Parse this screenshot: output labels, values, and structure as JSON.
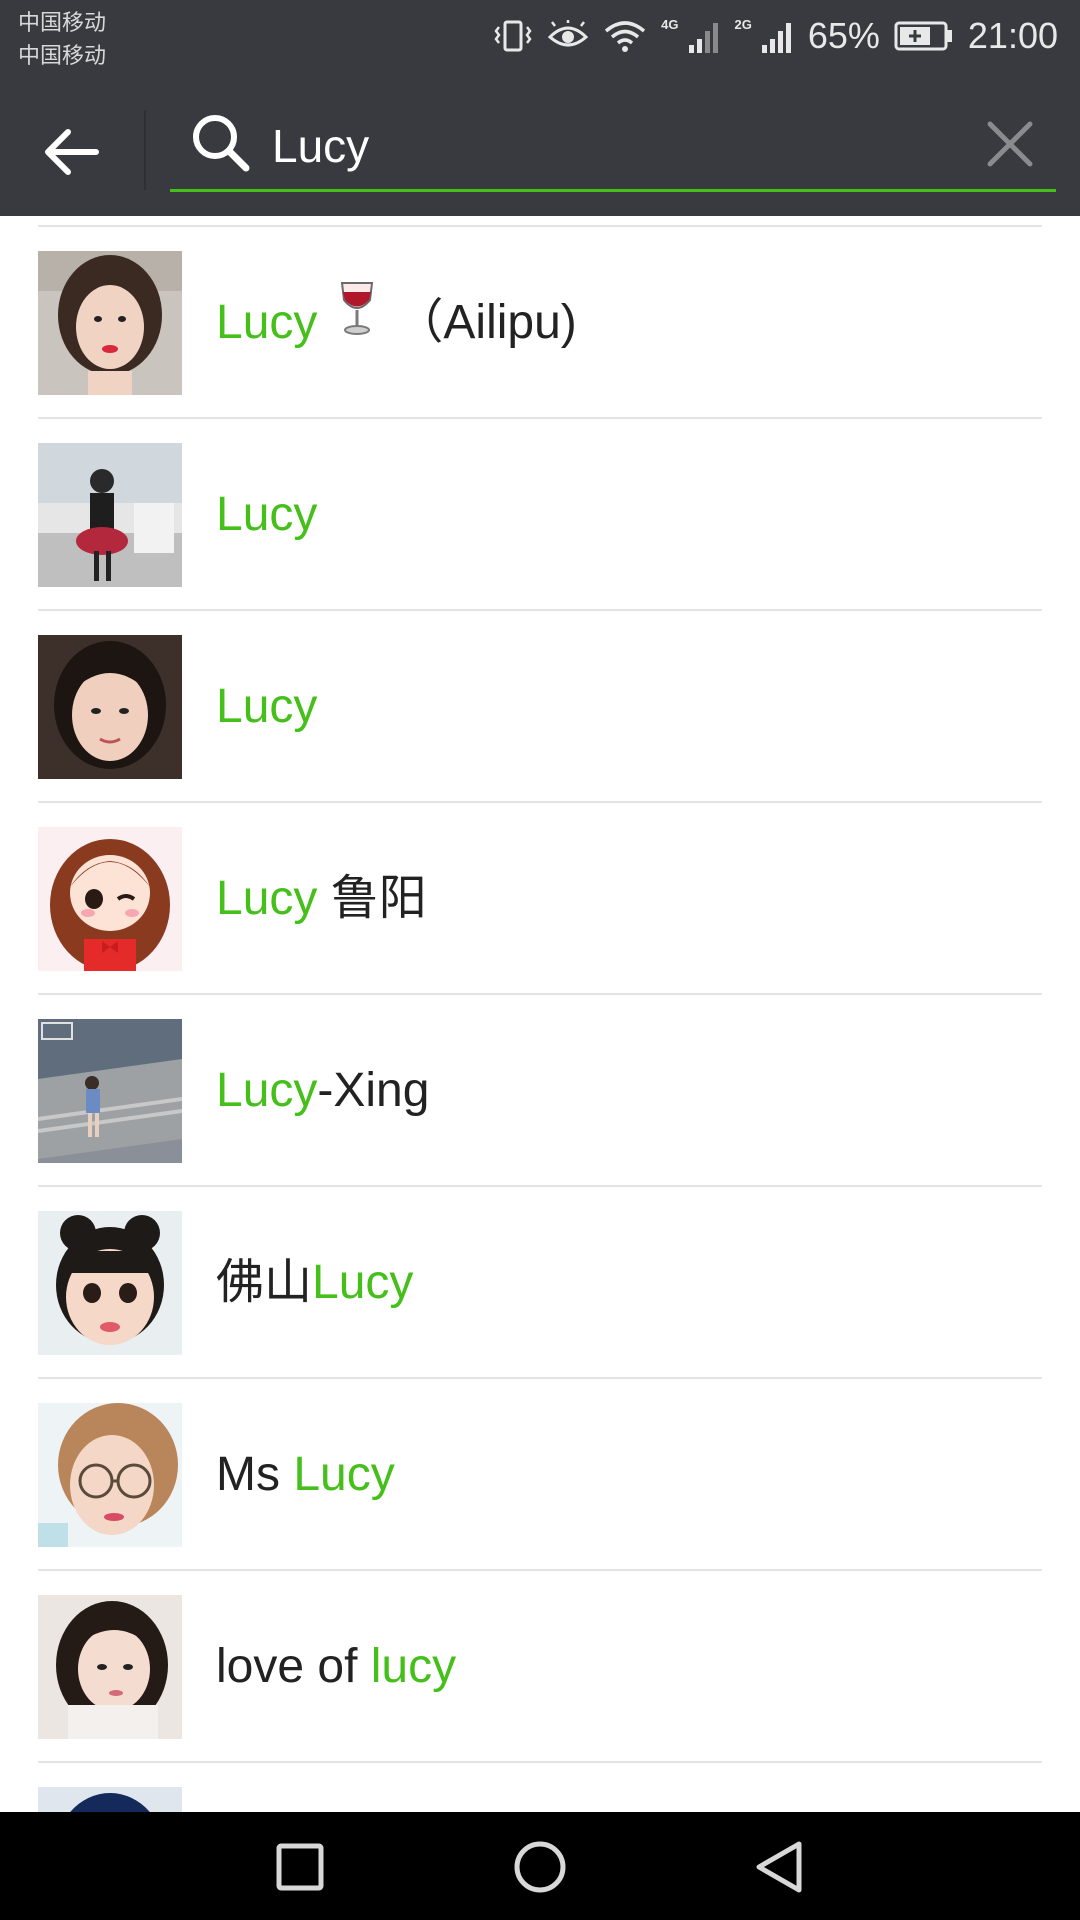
{
  "status_bar": {
    "carrier_1": "中国移动",
    "carrier_2": "中国移动",
    "net_tag_1": "4G",
    "net_tag_2": "2G",
    "battery": "65%",
    "time": "21:00"
  },
  "search": {
    "query": "Lucy",
    "icon": "search-icon",
    "accent_color": "#45c01a"
  },
  "results": [
    {
      "highlight": "Lucy",
      "suffix": "（Ailipu)",
      "emoji": "wine-glass"
    },
    {
      "highlight": "Lucy"
    },
    {
      "highlight": "Lucy"
    },
    {
      "highlight": "Lucy",
      "suffix": " 鲁阳"
    },
    {
      "highlight": "Lucy",
      "suffix": "-Xing"
    },
    {
      "prefix": "佛山",
      "highlight": "Lucy"
    },
    {
      "prefix": "Ms ",
      "highlight": "Lucy"
    },
    {
      "prefix": "love of ",
      "highlight": "lucy"
    }
  ],
  "nav_bar": {
    "recent_apps": "square-icon",
    "home": "circle-icon",
    "back": "triangle-back-icon"
  }
}
